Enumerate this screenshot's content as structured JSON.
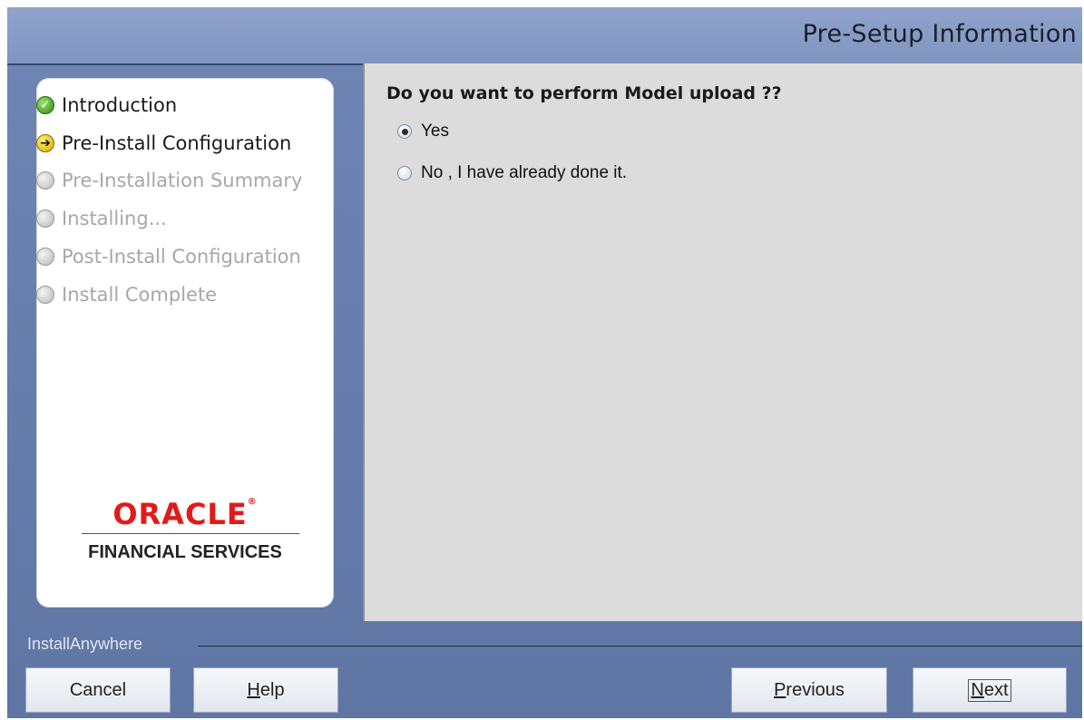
{
  "header": {
    "title": "Pre-Setup Information"
  },
  "steps": [
    {
      "label": "Introduction",
      "status": "done"
    },
    {
      "label": "Pre-Install Configuration",
      "status": "current"
    },
    {
      "label": "Pre-Installation Summary",
      "status": "pending"
    },
    {
      "label": "Installing...",
      "status": "pending"
    },
    {
      "label": "Post-Install Configuration",
      "status": "pending"
    },
    {
      "label": "Install Complete",
      "status": "pending"
    }
  ],
  "logo": {
    "brand": "ORACLE",
    "tagline": "FINANCIAL SERVICES"
  },
  "content": {
    "question": "Do you want to perform Model upload ??",
    "options": [
      {
        "label": "Yes",
        "selected": true
      },
      {
        "label": "No , I have already done it.",
        "selected": false
      }
    ]
  },
  "footer": {
    "vendor": "InstallAnywhere",
    "cancel": "Cancel",
    "help_mnemonic": "H",
    "help_rest": "elp",
    "previous_mnemonic": "P",
    "previous_rest": "revious",
    "next_mnemonic": "N",
    "next_rest": "ext"
  },
  "colors": {
    "accent": "#6f86b4",
    "header": "#8fa3cb",
    "content_bg": "#dcdcdc",
    "oracle_red": "#e21a1a"
  }
}
